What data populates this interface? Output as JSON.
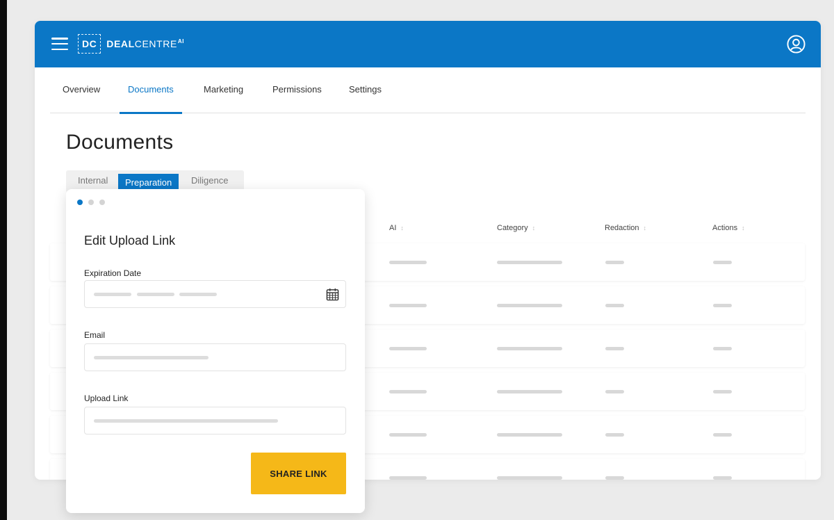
{
  "header": {
    "logo_mark": "DC",
    "brand_bold": "DEAL",
    "brand_light": "CENTRE",
    "brand_sup": "AI"
  },
  "nav": {
    "tabs": [
      "Overview",
      "Documents",
      "Marketing",
      "Permissions",
      "Settings"
    ],
    "active": "Documents"
  },
  "page": {
    "title": "Documents",
    "subtabs": [
      "Internal",
      "Preparation",
      "Diligence"
    ],
    "active_subtab": "Preparation"
  },
  "table": {
    "columns": [
      "AI",
      "Category",
      "Redaction",
      "Actions"
    ],
    "sort_glyph": "↕"
  },
  "modal": {
    "title": "Edit Upload Link",
    "step_current": 1,
    "step_total": 3,
    "expiration_label": "Expiration Date",
    "email_label": "Email",
    "upload_label": "Upload Link",
    "share_button": "SHARE LINK"
  },
  "colors": {
    "brand_blue": "#0b77c6",
    "accent_yellow": "#f5b818"
  },
  "icons": [
    "menu-icon",
    "user-account-icon",
    "calendar-icon",
    "sort-icon"
  ]
}
